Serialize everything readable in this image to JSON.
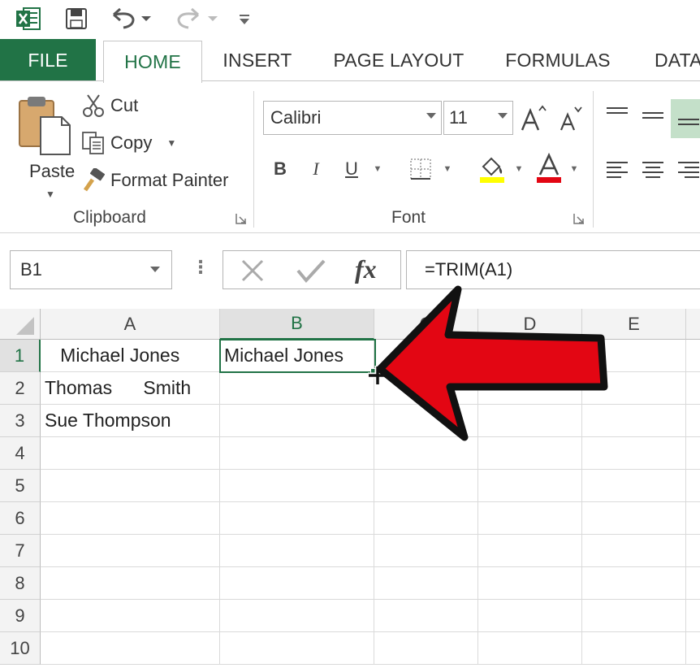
{
  "qat": {
    "excel_logo_icon": "excel-logo-icon",
    "save_icon": "save-icon",
    "undo_icon": "undo-icon",
    "redo_icon": "redo-icon",
    "customize_icon": "customize-qat-icon"
  },
  "tabs": [
    {
      "label": "FILE"
    },
    {
      "label": "HOME"
    },
    {
      "label": "INSERT"
    },
    {
      "label": "PAGE LAYOUT"
    },
    {
      "label": "FORMULAS"
    },
    {
      "label": "DATA"
    }
  ],
  "clipboard": {
    "paste_label": "Paste",
    "cut_label": "Cut",
    "copy_label": "Copy",
    "format_painter_label": "Format Painter",
    "group_label": "Clipboard"
  },
  "font": {
    "name": "Calibri",
    "size": "11",
    "group_label": "Font",
    "bold": "B",
    "italic": "I",
    "underline": "U"
  },
  "formula_bar": {
    "name_box": "B1",
    "dots": "⋮",
    "formula": "=TRIM(A1)"
  },
  "columns": [
    "A",
    "B",
    "C",
    "D",
    "E"
  ],
  "rows": [
    "1",
    "2",
    "3",
    "4",
    "5",
    "6",
    "7",
    "8",
    "9",
    "10"
  ],
  "cells": {
    "A1": "   Michael Jones",
    "B1": "Michael Jones",
    "A2": "Thomas      Smith",
    "A3": "Sue Thompson"
  },
  "colors": {
    "accent": "#217346",
    "arrow": "#e30613"
  }
}
